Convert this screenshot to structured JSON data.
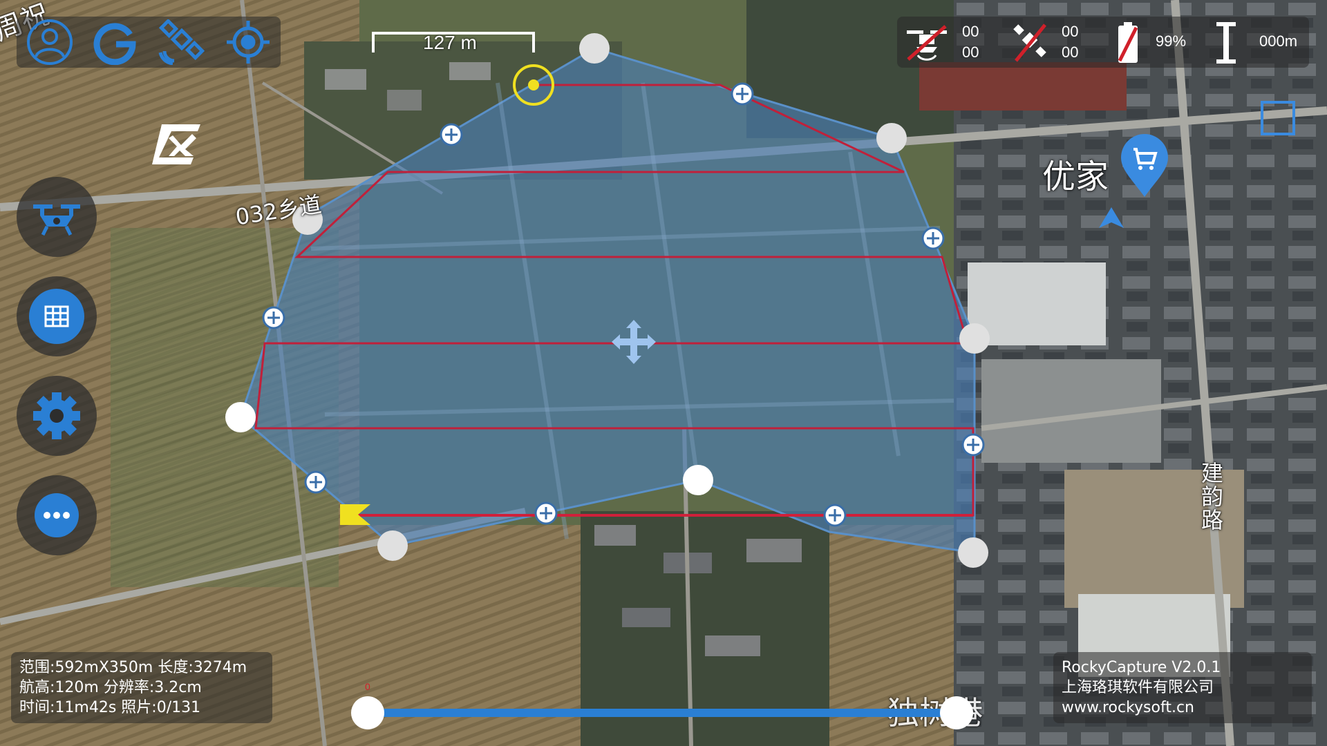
{
  "toolbar_left": {
    "icons": [
      "user-icon",
      "google-icon",
      "satellite-icon",
      "locate-icon"
    ]
  },
  "scale_bar": {
    "label": "127 m"
  },
  "status": {
    "drone_top": "00",
    "drone_bottom": "00",
    "satellite_top": "00",
    "satellite_bottom": "00",
    "battery": "99%",
    "altitude": "000m"
  },
  "side_menu": {
    "buttons": [
      "drone-icon",
      "grid-icon",
      "gear-icon",
      "more-icon"
    ]
  },
  "map_labels": {
    "road_032": "032乡道",
    "store_name": "优家",
    "road_jianyun": "建韵路",
    "lane_name": "独树港",
    "top_left_fragment": "周祝"
  },
  "mission_info": {
    "line1": "范围:592mX350m 长度:3274m",
    "line2": "航高:120m 分辨率:3.2cm",
    "line3": "时间:11m42s 照片:0/131"
  },
  "app_info": {
    "line1": "RockyCapture V2.0.1",
    "line2": "上海珞琪软件有限公司",
    "line3": "www.rockysoft.cn"
  },
  "slider": {
    "value": 1.0,
    "start_label": "0"
  },
  "colors": {
    "polygon_fill": "#4a7fb8",
    "flight_path": "#c0203a",
    "accent_blue": "#2a7fd4",
    "home_yellow": "#f0e020"
  }
}
